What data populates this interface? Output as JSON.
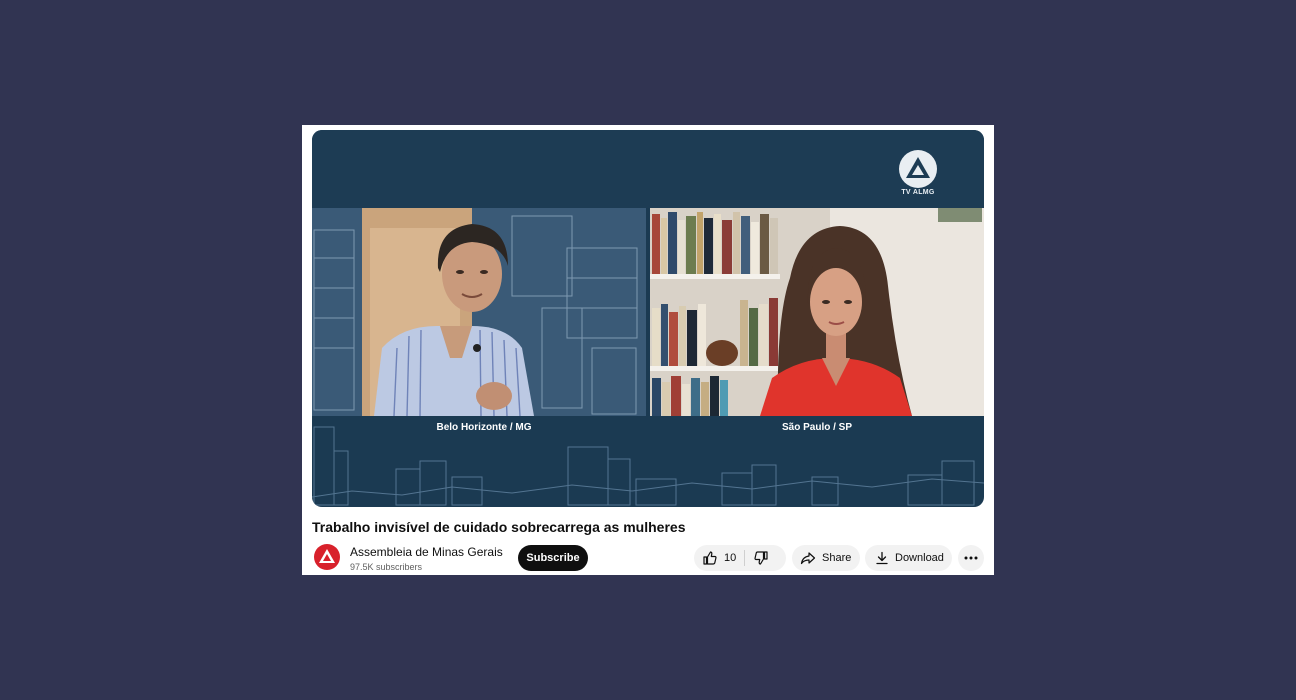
{
  "player": {
    "logo_text": "TV ALMG",
    "left_caption": "Belo Horizonte / MG",
    "right_caption": "São Paulo / SP",
    "brand_color": "#1d3c54"
  },
  "video": {
    "title": "Trabalho invisível de cuidado sobrecarrega as mulheres"
  },
  "channel": {
    "name": "Assembleia de Minas Gerais",
    "subscribers": "97.5K subscribers",
    "subscribe_label": "Subscribe",
    "avatar_color": "#d8212b"
  },
  "actions": {
    "like_count": "10",
    "share_label": "Share",
    "download_label": "Download",
    "icons": [
      "thumbs-up-icon",
      "thumbs-down-icon",
      "share-icon",
      "download-icon",
      "more-icon"
    ]
  }
}
